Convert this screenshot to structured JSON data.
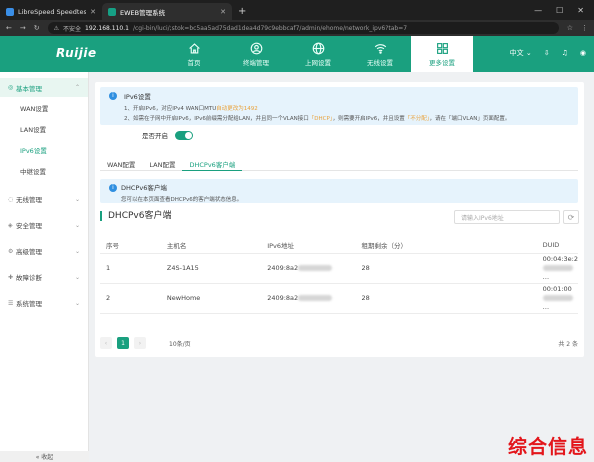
{
  "browser": {
    "tabs": [
      {
        "title": "LibreSpeed Speedtest"
      },
      {
        "title": "EWEB管理系统"
      }
    ],
    "new_tab": "+",
    "security_label": "不安全",
    "url_host": "192.168.110.1",
    "url_path": "/cgi-bin/luci/;stok=bc5aa5ad75dad1dea4d79c9ebbcaf7/admin/ehome/network_ipv6?tab=7"
  },
  "header": {
    "logo": "Ruijie",
    "nav": [
      {
        "label": "首页",
        "icon": "home-icon"
      },
      {
        "label": "终端管理",
        "icon": "user-icon"
      },
      {
        "label": "上网设置",
        "icon": "globe-icon"
      },
      {
        "label": "无线设置",
        "icon": "wifi-icon"
      },
      {
        "label": "更多设置",
        "icon": "grid-icon"
      }
    ],
    "active_nav": 4,
    "language": "中文 ⌄"
  },
  "sidebar": {
    "groups": [
      {
        "label": "基本管理",
        "icon": "network-icon",
        "open": true
      },
      {
        "label": "无线管理",
        "icon": "wifi-icon"
      },
      {
        "label": "安全管理",
        "icon": "shield-icon"
      },
      {
        "label": "高级管理",
        "icon": "settings-icon"
      },
      {
        "label": "故障诊断",
        "icon": "diagnose-icon"
      },
      {
        "label": "系统管理",
        "icon": "system-icon"
      }
    ],
    "subitems": [
      "WAN设置",
      "LAN设置",
      "IPv6设置",
      "中继设置"
    ],
    "active_subitem": 2,
    "collapse": "« 收起"
  },
  "main": {
    "notice": {
      "title": "IPv6设置",
      "line1_pre": "1、开启IPv6，对应IPv4 WAN口MTU",
      "line1_hl": "自动更改为1492",
      "line2_pre": "2、如需在子网中开启IPv6，IPv6前缀需分配给LAN，并且同一个VLAN接口",
      "line2_hl1": "「DHCP」",
      "line2_mid": "，则需要开启IPv6，并且设置",
      "line2_hl2": "「不分配」",
      "line2_post": "，请在「端口VLAN」页面配置。"
    },
    "enable_label": "是否开启",
    "enabled": true,
    "subtabs": [
      "WAN配置",
      "LAN配置",
      "DHCPv6客户端"
    ],
    "active_subtab": 2,
    "notice2": {
      "title": "DHCPv6客户端",
      "desc": "您可以在本页面查看DHCPv6的客户端状态信息。"
    },
    "section_title": "DHCPv6客户端",
    "search_placeholder": "请输入IPv6地址",
    "refresh_icon": "⟳",
    "table": {
      "headers": [
        "序号",
        "主机名",
        "IPv6地址",
        "租期剩余（分）",
        "DUID"
      ],
      "rows": [
        {
          "idx": "1",
          "host": "Z4S-1A15",
          "ip": "2409:8a2",
          "lease": "28",
          "duid1": "00:04:3e:2",
          "duid2": "…"
        },
        {
          "idx": "2",
          "host": "NewHome",
          "ip": "2409:8a2",
          "lease": "28",
          "duid1": "00:01:00",
          "duid2": "…"
        }
      ]
    },
    "pager": {
      "prev": "‹",
      "current": "1",
      "next": "›",
      "size": "10条/页",
      "total": "共 2 条"
    }
  },
  "watermark": "综合信息"
}
